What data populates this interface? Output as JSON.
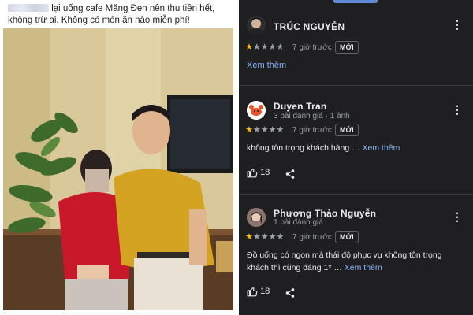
{
  "post": {
    "text_line1": "lại uống cafe Măng Đen nên thu tiền hết,",
    "text_line2": "không trừ ai. Không có món ăn nào miễn phí!"
  },
  "reviews": [
    {
      "name": "TRÚC NGUYỄN",
      "meta": "",
      "rating": 1,
      "time": "7 giờ trước",
      "badge": "MỚI",
      "link": "Xem thêm"
    },
    {
      "name": "Duyen Tran",
      "meta": "3 bài đánh giá · 1 ảnh",
      "rating": 1,
      "time": "7 giờ trước",
      "badge": "MỚI",
      "body": "không tôn trọng khách hàng …",
      "more": "Xem thêm",
      "likes": "18"
    },
    {
      "name": "Phương Thảo Nguyễn",
      "meta": "1 bài đánh giá",
      "rating": 1,
      "time": "7 giờ trước",
      "badge": "MỚI",
      "body_line1": "Đồ uống có ngon mà thái độ phục vụ không tôn trọng",
      "body_line2": "khách thì cũng đáng 1* …",
      "more": "Xem thêm",
      "likes": "18"
    }
  ],
  "icons": {
    "more_menu": "kebab-icon",
    "thumbs_up": "thumbs-up-icon",
    "share": "share-icon",
    "star": "star-icon"
  },
  "colors": {
    "panel_bg": "#1f1f21",
    "star_on": "#fbbc04",
    "star_off": "#9aa0a6",
    "link": "#8ab4f8"
  }
}
